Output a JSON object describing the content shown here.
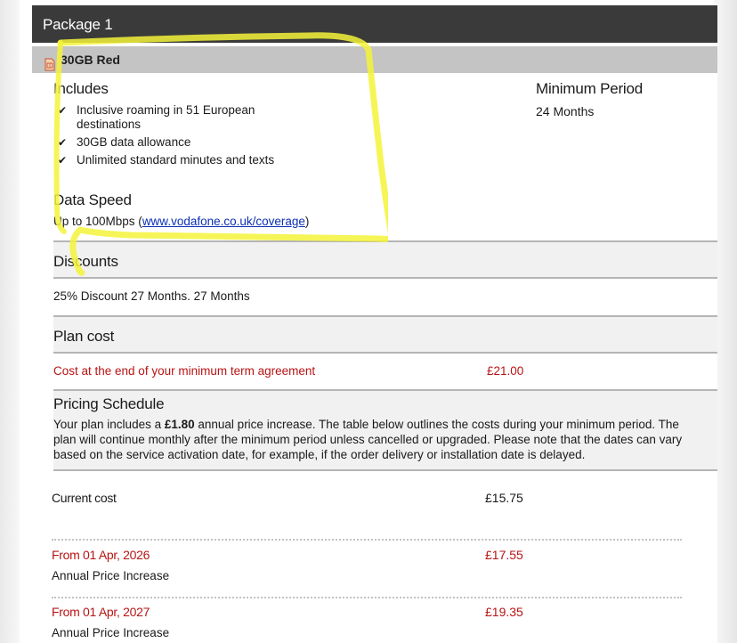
{
  "package": {
    "title": "Package 1",
    "plan_name": "30GB Red"
  },
  "includes": {
    "title": "Includes",
    "items": [
      {
        "line1": "Inclusive roaming in 51 European",
        "line2": "destinations"
      },
      {
        "line1": "30GB data allowance",
        "line2": ""
      },
      {
        "line1": "Unlimited standard minutes and texts",
        "line2": ""
      }
    ]
  },
  "minimum_period": {
    "title": "Minimum Period",
    "value": "24 Months"
  },
  "data_speed": {
    "title": "Data Speed",
    "prefix": "Up to 100Mbps (",
    "link_text": "www.vodafone.co.uk/coverage",
    "suffix": ")"
  },
  "discounts": {
    "title": "Discounts",
    "text": "25% Discount 27 Months. 27 Months"
  },
  "plan_cost": {
    "title": "Plan cost",
    "label": "Cost at the end of your minimum term agreement",
    "value": "£21.00"
  },
  "pricing_schedule": {
    "title": "Pricing Schedule",
    "text_before": "Your plan includes a ",
    "amount": "£1.80",
    "text_after": " annual price increase. The table below outlines the costs during your minimum period. The plan will continue monthly after the minimum period unless cancelled or upgraded. Please note that the dates can vary based on the service activation date, for example, if the order delivery or installation date is delayed.",
    "current": {
      "label": "Current cost",
      "value": "£15.75"
    },
    "rows": [
      {
        "label": "From 01 Apr, 2026",
        "value": "£17.55",
        "note": "Annual Price Increase"
      },
      {
        "label": "From 01 Apr, 2027",
        "value": "£19.35",
        "note": "Annual Price Increase"
      }
    ]
  },
  "colors": {
    "header_bg": "#3a3a3a",
    "plan_bar_bg": "#c4c4c4",
    "accent_red": "#b81414",
    "link_blue": "#0b2fb4",
    "highlighter": "#f5f33a"
  }
}
